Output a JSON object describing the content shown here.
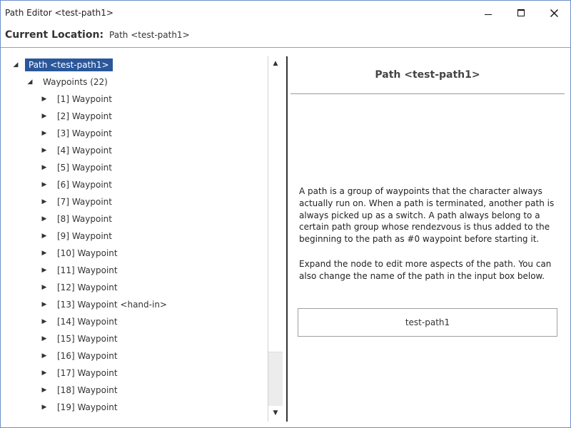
{
  "window": {
    "title": "Path Editor <test-path1>",
    "controls": {
      "minimize": "minimize",
      "maximize": "maximize",
      "close": "close"
    }
  },
  "location": {
    "label": "Current Location:",
    "value": "Path <test-path1>"
  },
  "tree": {
    "root": {
      "label": "Path <test-path1>",
      "expanded": true,
      "selected": true
    },
    "group": {
      "label": "Waypoints (22)",
      "expanded": true
    },
    "items": [
      {
        "label": "[1] Waypoint"
      },
      {
        "label": "[2] Waypoint"
      },
      {
        "label": "[3] Waypoint"
      },
      {
        "label": "[4] Waypoint"
      },
      {
        "label": "[5] Waypoint"
      },
      {
        "label": "[6] Waypoint"
      },
      {
        "label": "[7] Waypoint"
      },
      {
        "label": "[8] Waypoint"
      },
      {
        "label": "[9] Waypoint"
      },
      {
        "label": "[10] Waypoint"
      },
      {
        "label": "[11] Waypoint"
      },
      {
        "label": "[12] Waypoint"
      },
      {
        "label": "[13] Waypoint <hand-in>"
      },
      {
        "label": "[14] Waypoint"
      },
      {
        "label": "[15] Waypoint"
      },
      {
        "label": "[16] Waypoint"
      },
      {
        "label": "[17] Waypoint"
      },
      {
        "label": "[18] Waypoint"
      },
      {
        "label": "[19] Waypoint"
      }
    ],
    "icons": {
      "expanded": "triangle-down-icon",
      "collapsed": "triangle-right-icon"
    }
  },
  "detail": {
    "title": "Path <test-path1>",
    "description_1": "A path is a group of waypoints that the character always actually run on. When a path is terminated, another path is always picked up as a switch. A path always belong to a certain path group whose rendezvous is thus added to the beginning to the path as #0 waypoint before starting it.",
    "description_2": "Expand the node to edit more aspects of the path. You can also change the name of the path in the input box below.",
    "name_input": {
      "value": "test-path1"
    }
  },
  "colors": {
    "selection": "#2b579a",
    "window_border": "#6b8fc7",
    "splitter": "#333333"
  }
}
